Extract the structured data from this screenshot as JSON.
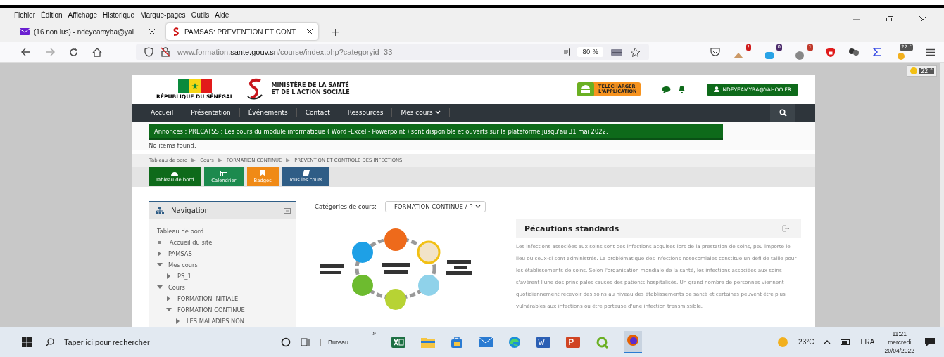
{
  "menu_bar": [
    "Fichier",
    "Édition",
    "Affichage",
    "Historique",
    "Marque-pages",
    "Outils",
    "Aide"
  ],
  "tabs": [
    {
      "label": "(16 non lus) - ndeyeamyba@yal",
      "kind": "mail",
      "selected": false
    },
    {
      "label": "PAMSAS: PREVENTION ET CONT",
      "kind": "site",
      "selected": true
    }
  ],
  "new_tab": "+",
  "address": {
    "host_prefix": "www.formation.",
    "host": "sante.gouv.sn",
    "path": "/course/index.php?categoryid=33",
    "zoom": "80 %"
  },
  "extension_badges": [
    {
      "text": "!",
      "color": "#d01c1c"
    },
    {
      "text": "0",
      "color": "#4b2a6a"
    },
    {
      "text": "1",
      "color": "#c0392b"
    },
    {
      "text": "22 °",
      "color": "#555555"
    }
  ],
  "weather_badge": "22 °",
  "site": {
    "flag_caption": "RÉPUBLIQUE DU SÉNÉGAL",
    "ministry": [
      "MINISTÈRE DE LA SANTÉ",
      "ET DE L'ACTION SOCIALE"
    ],
    "app_button": [
      "TÉLÉCHARGER",
      "L'APPLICATION"
    ],
    "user": "NDEYEAMYBA@YAHOO.FR"
  },
  "nav": [
    {
      "label": "Accueil",
      "has_menu": false
    },
    {
      "label": "Présentation",
      "has_menu": false
    },
    {
      "label": "Événements",
      "has_menu": false
    },
    {
      "label": "Contact",
      "has_menu": false
    },
    {
      "label": "Ressources",
      "has_menu": false
    },
    {
      "label": "Mes cours",
      "has_menu": true
    }
  ],
  "announcement": "Annonces : PRECATSS : Les cours du module informatique ( Word -Excel - Powerpoint ) sont disponible et ouverts sur la plateforme jusqu'au 31 mai 2022.",
  "no_items": "No items found.",
  "breadcrumb": [
    "Tableau de bord",
    "Cours",
    "FORMATION CONTINUE",
    "PREVENTION ET CONTROLE DES INFECTIONS"
  ],
  "quick_buttons": [
    {
      "label": "Tableau de bord",
      "kind": "dashboard",
      "color": "#0e6a1a"
    },
    {
      "label": "Calendrier",
      "kind": "calendar",
      "color": "#1c8a4e"
    },
    {
      "label": "Badges",
      "kind": "badge",
      "color": "#f08a16"
    },
    {
      "label": "Tous les cours",
      "kind": "courses",
      "color": "#2f5d86"
    }
  ],
  "navigation_block": {
    "title": "Navigation",
    "items": [
      {
        "label": "Tableau de bord",
        "kind": "link"
      },
      {
        "label": "Accueil du site",
        "kind": "bullet"
      },
      {
        "label": "PAMSAS",
        "kind": "branch",
        "expanded": false
      },
      {
        "label": "Mes cours",
        "kind": "branch",
        "expanded": true,
        "children": [
          {
            "label": "PS_1",
            "kind": "branch",
            "expanded": false
          }
        ]
      },
      {
        "label": "Cours",
        "kind": "branch",
        "expanded": true,
        "children": [
          {
            "label": "FORMATION INITIALE",
            "kind": "branch",
            "expanded": false
          },
          {
            "label": "FORMATION CONTINUE",
            "kind": "branch",
            "expanded": true,
            "children": [
              {
                "label": "LES MALADIES NON",
                "kind": "branch",
                "expanded": false
              }
            ]
          }
        ]
      }
    ]
  },
  "category_select": {
    "label": "Catégories de cours:",
    "value": "FORMATION CONTINUE / P"
  },
  "article": {
    "title": "Pécautions standards",
    "text": "Les infections associées aux soins sont des infections acquises lors de la prestation de soins, peu importe le lieu où ceux-ci sont administrés. La problématique des infections nosocomiales constitue un défi de taille pour les établissements de soins. Selon l'organisation mondiale de la santé, les infections associées aux soins s'avèrent l'une des principales causes des patients hospitalisés. Un grand nombre de personnes viennent quotidiennement recevoir des soins au niveau des établissements de santé et certaines peuvent être plus vulnérables aux infections ou être porteuse d'une infection transmissible."
  },
  "taskbar": {
    "search_placeholder": "Taper ici pour rechercher",
    "toolbar_label": "Bureau",
    "toolbar_chevron": "»",
    "temperature": "23°C",
    "language": "FRA",
    "time": "11:21",
    "day": "mercredi",
    "date": "20/04/2022"
  }
}
